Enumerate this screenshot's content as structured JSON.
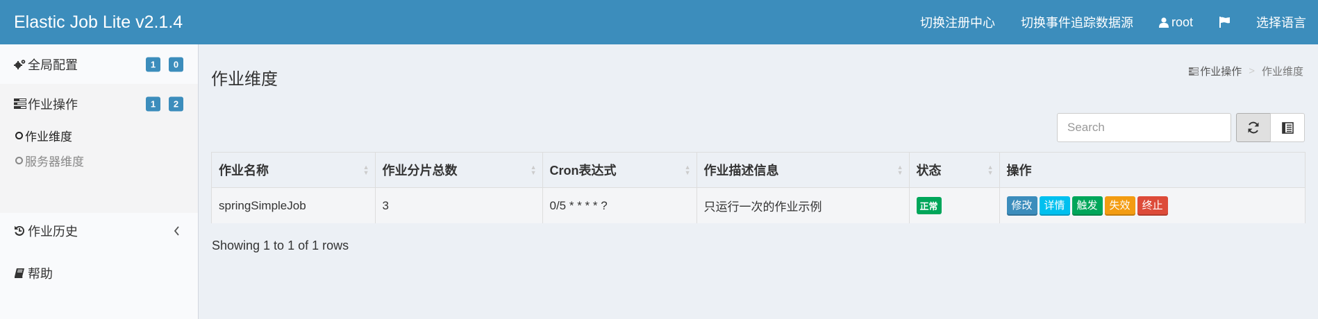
{
  "header": {
    "brand": "Elastic Job Lite v2.1.4",
    "nav": {
      "registry": "切换注册中心",
      "event_source": "切换事件追踪数据源",
      "user": "root",
      "language": "选择语言"
    }
  },
  "sidebar": {
    "global_config": {
      "label": "全局配置",
      "badge1": "1",
      "badge2": "0"
    },
    "job_ops": {
      "label": "作业操作",
      "badge1": "1",
      "badge2": "2"
    },
    "sub_job_dimension": "作业维度",
    "sub_server_dimension": "服务器维度",
    "job_history": "作业历史",
    "help": "帮助"
  },
  "page": {
    "title": "作业维度",
    "breadcrumb": {
      "parent": "作业操作",
      "sep": ">",
      "current": "作业维度"
    }
  },
  "toolbar": {
    "search_placeholder": "Search"
  },
  "table": {
    "headers": [
      "作业名称",
      "作业分片总数",
      "Cron表达式",
      "作业描述信息",
      "状态",
      "操作"
    ],
    "rows": [
      {
        "name": "springSimpleJob",
        "shards": "3",
        "cron": "0/5 * * * * ?",
        "description": "只运行一次的作业示例",
        "status": "正常",
        "actions": {
          "modify": "修改",
          "detail": "详情",
          "trigger": "触发",
          "disable": "失效",
          "shutdown": "终止"
        }
      }
    ]
  },
  "footer": {
    "showing": "Showing 1 to 1 of 1 rows"
  },
  "colors": {
    "header_bg": "#3c8dbc",
    "badge_bg": "#3c8dbc",
    "status_green": "#00a65a",
    "modify": "#3c8dbc",
    "detail": "#00c0ef",
    "trigger": "#00a65a",
    "disable": "#f39c12",
    "shutdown": "#dd4b39"
  }
}
